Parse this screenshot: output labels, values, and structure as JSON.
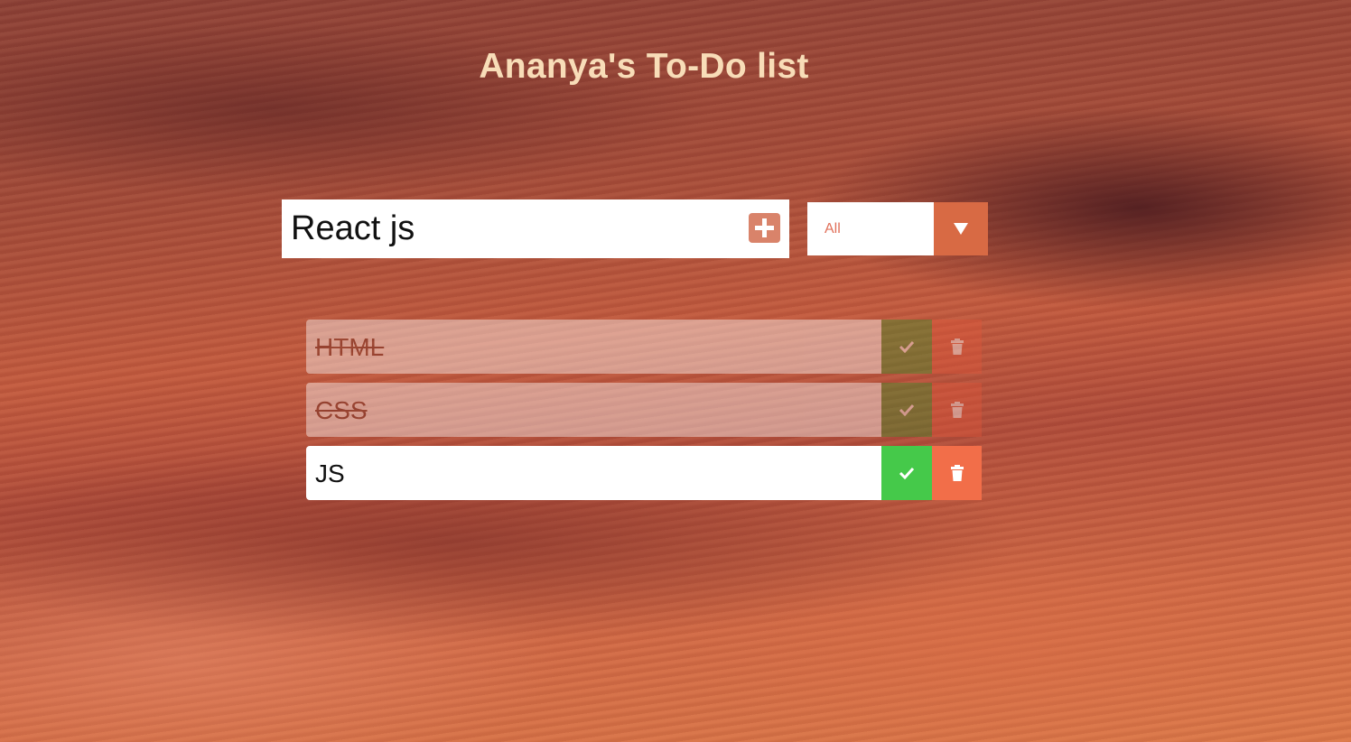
{
  "app": {
    "title": "Ananya's To-Do list"
  },
  "form": {
    "input_value": "React js",
    "add_icon": "plus-square-icon"
  },
  "filter": {
    "selected": "All",
    "arrow_icon": "caret-down-icon"
  },
  "todos": [
    {
      "text": "HTML",
      "completed": true
    },
    {
      "text": "CSS",
      "completed": true
    },
    {
      "text": "JS",
      "completed": false
    }
  ],
  "colors": {
    "title": "#f8ddb8",
    "accent": "#d86a44",
    "complete_button": "#45c94a",
    "delete_button": "#f26e49"
  }
}
